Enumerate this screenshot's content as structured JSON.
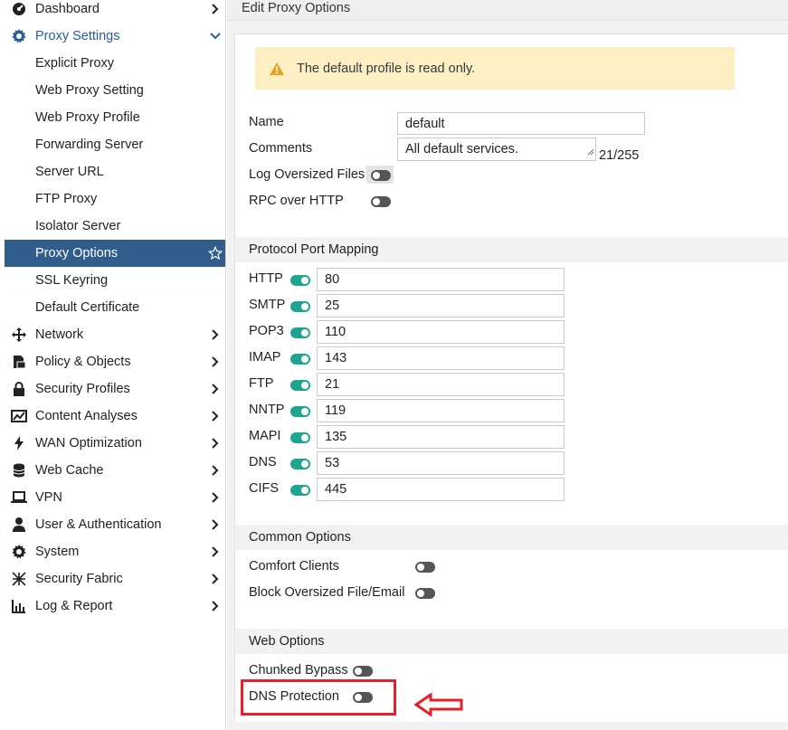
{
  "sidebar": {
    "items": [
      {
        "label": "Dashboard",
        "icon": "dashboard-icon",
        "chevron": "right"
      },
      {
        "label": "Proxy Settings",
        "icon": "gear-icon",
        "chevron": "down"
      },
      {
        "label": "Explicit Proxy"
      },
      {
        "label": "Web Proxy Setting"
      },
      {
        "label": "Web Proxy Profile"
      },
      {
        "label": "Forwarding Server"
      },
      {
        "label": "Server URL"
      },
      {
        "label": "FTP Proxy"
      },
      {
        "label": "Isolator Server"
      },
      {
        "label": "Proxy Options",
        "active": true
      },
      {
        "label": "SSL Keyring"
      },
      {
        "label": "Default Certificate"
      },
      {
        "label": "Network",
        "icon": "move-arrows-icon"
      },
      {
        "label": "Policy & Objects",
        "icon": "policy-icon"
      },
      {
        "label": "Security Profiles",
        "icon": "lock-icon"
      },
      {
        "label": "Content Analyses",
        "icon": "image-chart-icon"
      },
      {
        "label": "WAN Optimization",
        "icon": "bolt-icon"
      },
      {
        "label": "Web Cache",
        "icon": "database-icon"
      },
      {
        "label": "VPN",
        "icon": "laptop-icon"
      },
      {
        "label": "User & Authentication",
        "icon": "user-icon"
      },
      {
        "label": "System",
        "icon": "gear-icon"
      },
      {
        "label": "Security Fabric",
        "icon": "fabric-icon"
      },
      {
        "label": "Log & Report",
        "icon": "bar-chart-icon"
      }
    ]
  },
  "header": {
    "title": "Edit Proxy Options"
  },
  "warning": {
    "text": "The default profile is read only."
  },
  "form": {
    "name_label": "Name",
    "name_value": "default",
    "comments_label": "Comments",
    "comments_value": "All default services.",
    "comments_counter": "21/255",
    "log_oversized_label": "Log Oversized Files",
    "rpc_label": "RPC over HTTP"
  },
  "protocol_section": {
    "title": "Protocol Port Mapping",
    "rows": [
      {
        "label": "HTTP",
        "value": "80",
        "enabled": true
      },
      {
        "label": "SMTP",
        "value": "25",
        "enabled": true
      },
      {
        "label": "POP3",
        "value": "110",
        "enabled": true
      },
      {
        "label": "IMAP",
        "value": "143",
        "enabled": true
      },
      {
        "label": "FTP",
        "value": "21",
        "enabled": true
      },
      {
        "label": "NNTP",
        "value": "119",
        "enabled": true
      },
      {
        "label": "MAPI",
        "value": "135",
        "enabled": true
      },
      {
        "label": "DNS",
        "value": "53",
        "enabled": true
      },
      {
        "label": "CIFS",
        "value": "445",
        "enabled": true
      }
    ]
  },
  "common_section": {
    "title": "Common Options",
    "comfort_label": "Comfort Clients",
    "block_label": "Block Oversized File/Email"
  },
  "web_section": {
    "title": "Web Options",
    "chunked_label": "Chunked Bypass",
    "dns_label": "DNS Protection"
  },
  "colors": {
    "accent": "#305d8c",
    "toggle_on": "#1fa58f",
    "warning_bg": "#fcefc4",
    "highlight": "#e0202a"
  }
}
